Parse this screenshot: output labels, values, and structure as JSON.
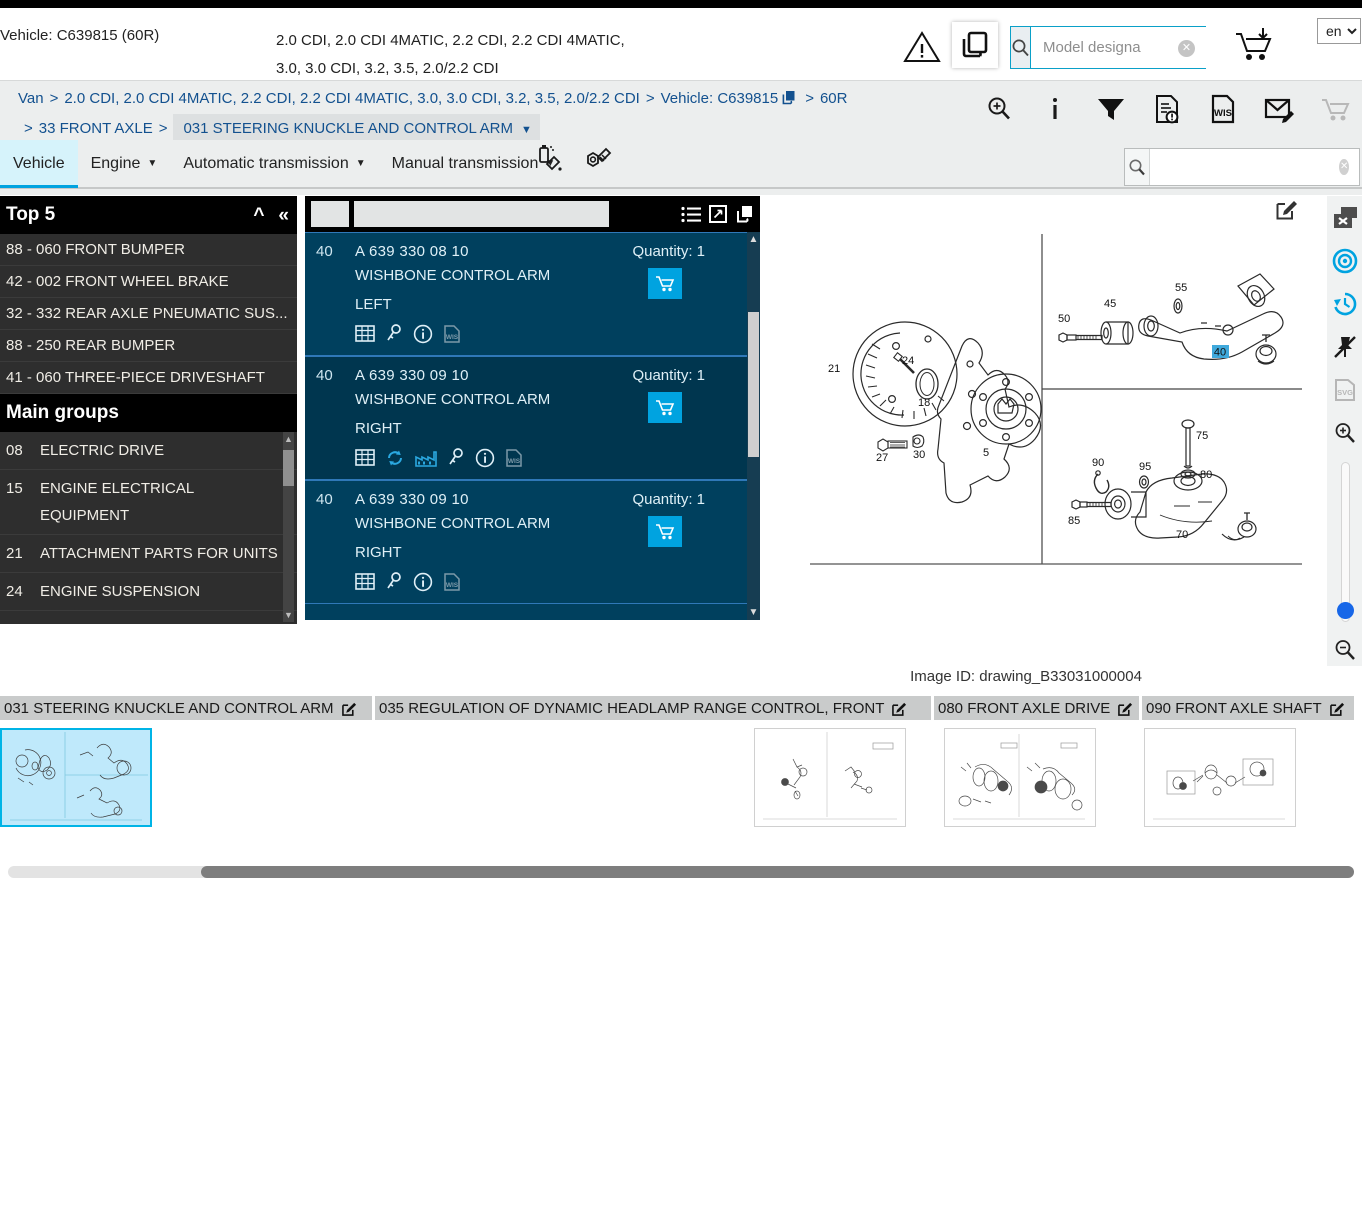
{
  "header": {
    "vehicle_label": "Vehicle: C639815 (60R)",
    "models_line1": "2.0 CDI, 2.0 CDI 4MATIC, 2.2 CDI, 2.2 CDI 4MATIC,",
    "models_line2": "3.0, 3.0 CDI, 3.2, 3.5, 2.0/2.2 CDI",
    "search_placeholder": "Model designa",
    "search_value": "",
    "language": "en",
    "icons": {
      "warning": "warning-triangle-icon",
      "copy": "copy-icon",
      "search": "search-icon",
      "clear": "clear-icon",
      "cart": "cart-add-icon"
    }
  },
  "breadcrumb": {
    "items": [
      {
        "label": "Van",
        "active": false
      },
      {
        "label": "2.0 CDI, 2.0 CDI 4MATIC, 2.2 CDI, 2.2 CDI 4MATIC, 3.0, 3.0 CDI, 3.2, 3.5, 2.0/2.2 CDI",
        "active": false
      },
      {
        "label": "Vehicle: C639815",
        "active": false,
        "icon": "copy-icon"
      },
      {
        "label": "60R",
        "active": false
      },
      {
        "label": "33 FRONT AXLE",
        "active": false
      },
      {
        "label": "031 STEERING KNUCKLE AND CONTROL ARM",
        "active": true,
        "caret": true
      }
    ],
    "separator": ">",
    "tools": [
      "zoom-in-icon",
      "info-icon",
      "filter-icon",
      "document-alert-icon",
      "wis-document-icon",
      "mail-edit-icon",
      "cart-icon"
    ]
  },
  "tabs": {
    "items": [
      {
        "label": "Vehicle",
        "active": true,
        "caret": false
      },
      {
        "label": "Engine",
        "active": false,
        "caret": true
      },
      {
        "label": "Automatic transmission",
        "active": false,
        "caret": true
      },
      {
        "label": "Manual transmission",
        "active": false,
        "caret": true
      }
    ],
    "extra_icons": [
      "paint-spray-icon",
      "bolt-nut-icon"
    ],
    "search_value": "",
    "search_placeholder": ""
  },
  "sidebar": {
    "top5_title": "Top 5",
    "collapse_icons": [
      "chevron-up-icon",
      "double-chevron-left-icon"
    ],
    "top5_items": [
      "88 - 060 FRONT BUMPER",
      "42 - 002 FRONT WHEEL BRAKE",
      "32 - 332 REAR AXLE PNEUMATIC SUS...",
      "88 - 250 REAR BUMPER",
      "41 - 060 THREE-PIECE DRIVESHAFT"
    ],
    "main_groups_title": "Main groups",
    "main_groups": [
      {
        "num": "08",
        "name": "ELECTRIC DRIVE"
      },
      {
        "num": "15",
        "name": "ENGINE ELECTRICAL EQUIPMENT"
      },
      {
        "num": "21",
        "name": "ATTACHMENT PARTS FOR UNITS"
      },
      {
        "num": "24",
        "name": "ENGINE SUSPENSION"
      }
    ]
  },
  "parts_panel": {
    "filter_value": "",
    "header_icons": [
      "list-view-icon",
      "expand-icon",
      "copy-icon"
    ],
    "quantity_label": "Quantity:",
    "rows": [
      {
        "position": "40",
        "part_number": "A 639 330 08 10",
        "description_line1": "WISHBONE CONTROL ARM",
        "description_line2": "LEFT",
        "quantity": "1",
        "icons": [
          "table-icon",
          "key-icon",
          "info-icon",
          "wis-icon"
        ],
        "cart_icon": "cart-icon"
      },
      {
        "position": "40",
        "part_number": "A 639 330 09 10",
        "description_line1": "WISHBONE CONTROL ARM",
        "description_line2": "RIGHT",
        "quantity": "1",
        "icons": [
          "table-icon",
          "refresh-icon",
          "factory-icon",
          "key-icon",
          "info-icon",
          "wis-icon"
        ],
        "cart_icon": "cart-icon"
      },
      {
        "position": "40",
        "part_number": "A 639 330 09 10",
        "description_line1": "WISHBONE CONTROL ARM",
        "description_line2": "RIGHT",
        "quantity": "1",
        "icons": [
          "table-icon",
          "key-icon",
          "info-icon",
          "wis-icon"
        ],
        "cart_icon": "cart-icon"
      }
    ]
  },
  "drawing": {
    "image_id": "Image ID: drawing_B33031000004",
    "callouts_left": [
      "21",
      "24",
      "18",
      "27",
      "30",
      "5"
    ],
    "callouts_top_right": [
      "50",
      "45",
      "55",
      "40"
    ],
    "callouts_bottom_right": [
      "90",
      "95",
      "75",
      "80",
      "85",
      "70"
    ],
    "highlighted_callout": "40",
    "highlight_color": "#3fa9dc",
    "tools": [
      "close-window-icon",
      "target-icon",
      "history-icon",
      "unpin-icon",
      "svg-icon",
      "zoom-in-icon",
      "zoom-slider",
      "zoom-out-icon"
    ],
    "edit_icon": "edit-icon",
    "zoom_slider_value": 12
  },
  "thumbnail_strip": {
    "items": [
      {
        "title": "031 STEERING KNUCKLE AND CONTROL ARM",
        "selected": true,
        "edit_icon": "edit-icon"
      },
      {
        "title": "035 REGULATION OF DYNAMIC HEADLAMP RANGE CONTROL, FRONT",
        "selected": false,
        "edit_icon": "edit-icon"
      },
      {
        "title": "080 FRONT AXLE DRIVE",
        "selected": false,
        "edit_icon": "edit-icon"
      },
      {
        "title": "090 FRONT AXLE SHAFT",
        "selected": false,
        "edit_icon": "edit-icon"
      }
    ]
  },
  "colors": {
    "accent_blue": "#00a3e0",
    "panel_dark_blue": "#00405e",
    "sidebar_dark": "#2e2e2e",
    "link_blue": "#13518f",
    "selection_cyan": "#bfe9fb"
  }
}
